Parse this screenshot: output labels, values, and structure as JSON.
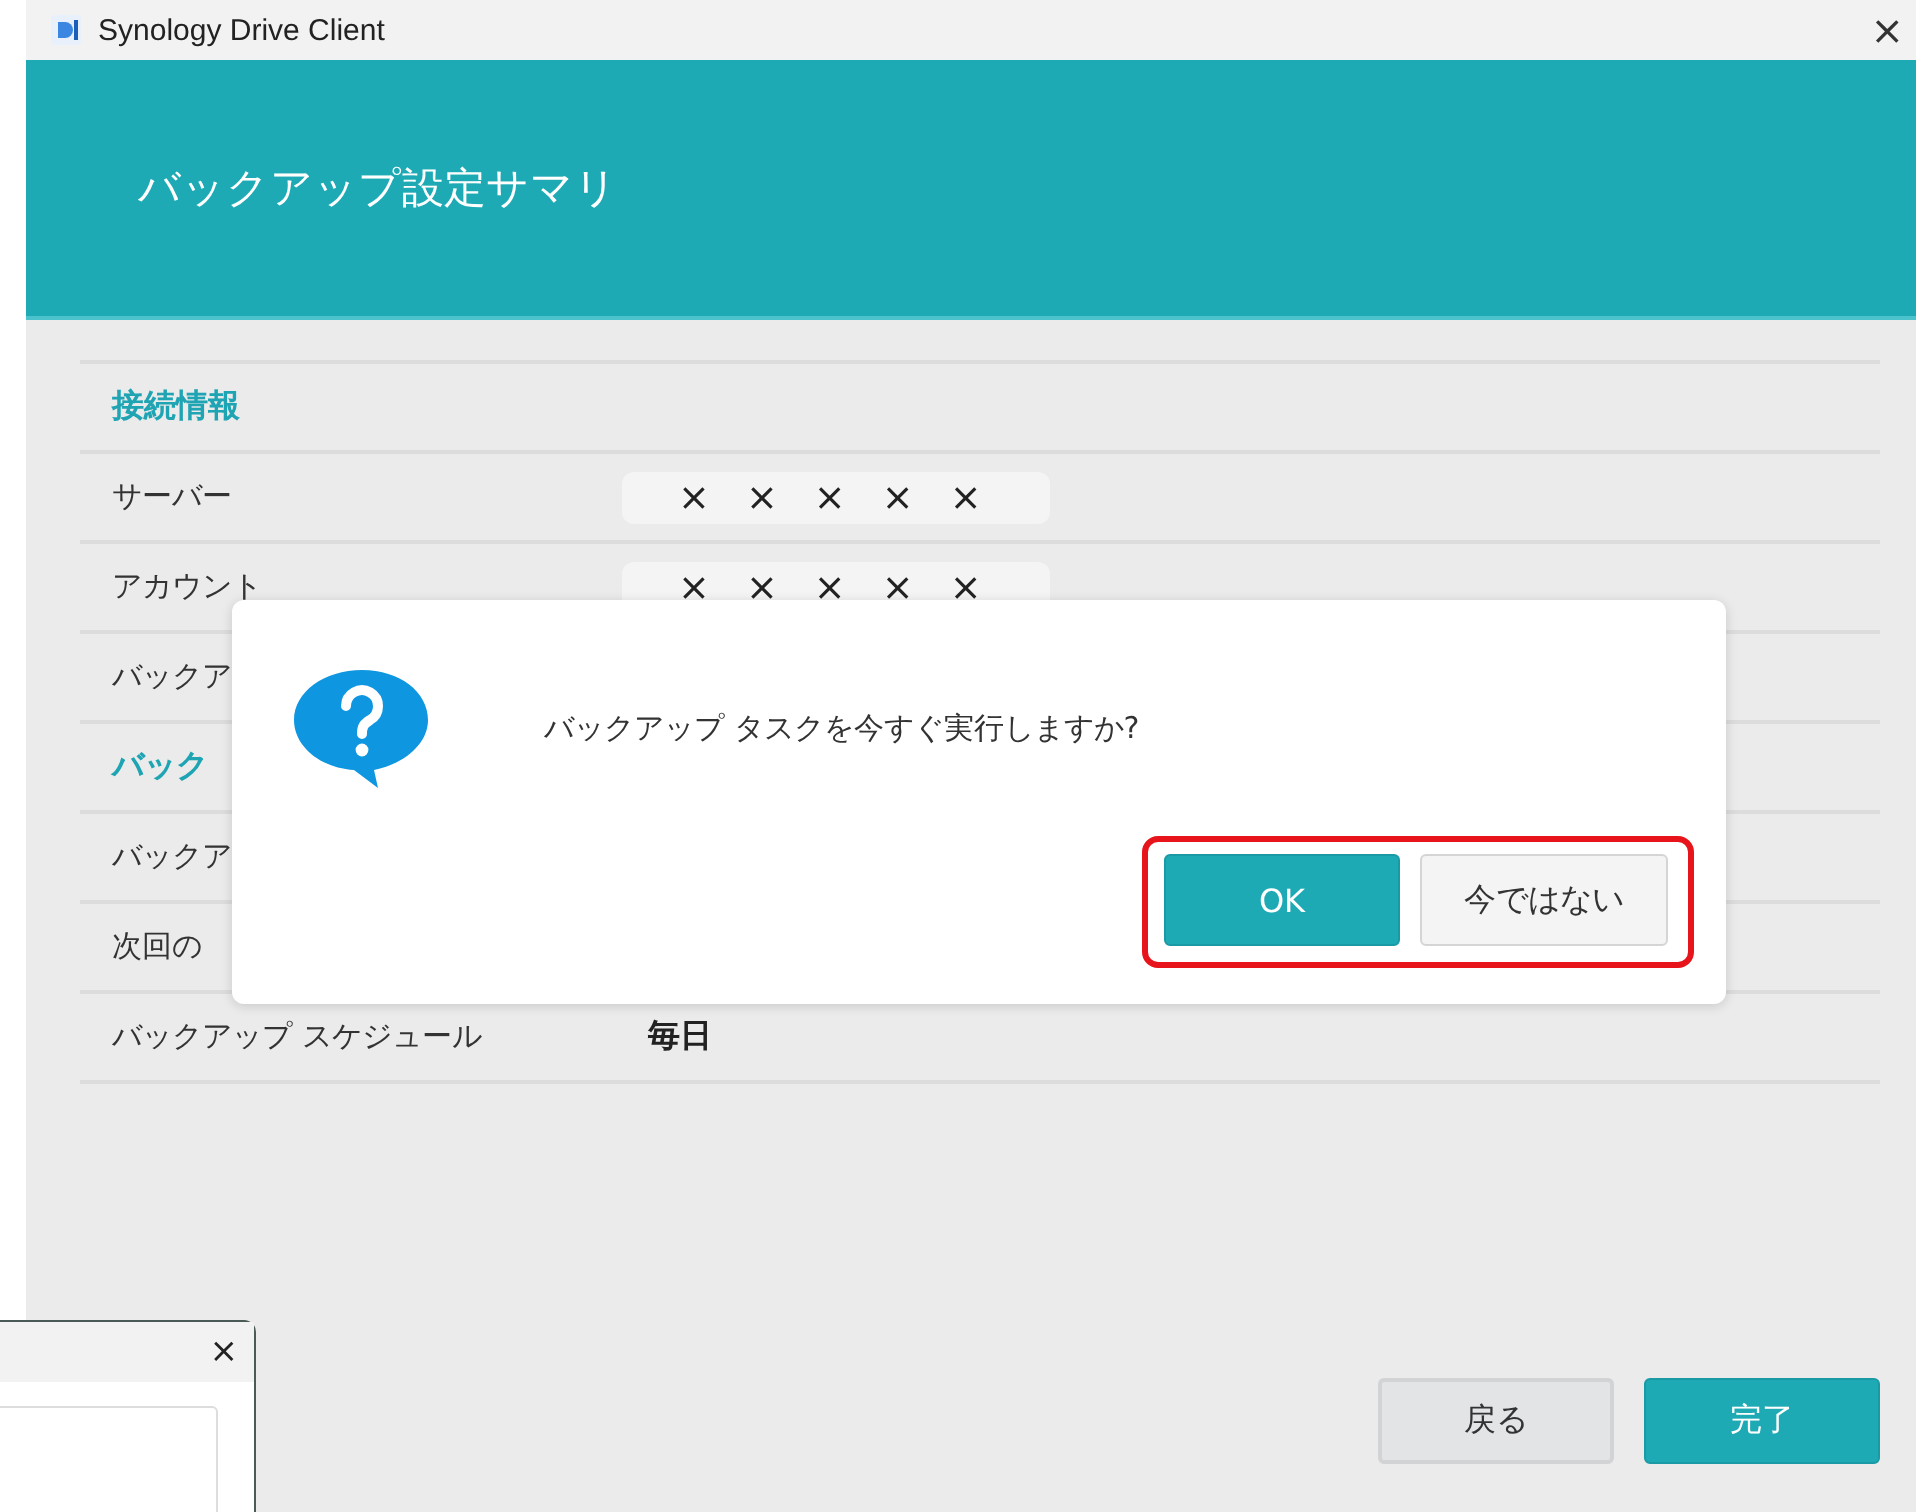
{
  "window": {
    "title": "Synology Drive Client",
    "close": "×"
  },
  "header": {
    "title": "バックアップ設定サマリ"
  },
  "sections": [
    {
      "heading": "接続情報",
      "rows": [
        {
          "label": "サーバー",
          "value": "× × × × ×",
          "masked": true
        },
        {
          "label": "アカウント",
          "value": "× × × × ×",
          "masked": true
        },
        {
          "label": "バックア"
        }
      ]
    },
    {
      "heading": "バック",
      "rows": [
        {
          "label": "バックア"
        },
        {
          "label": "次回の"
        },
        {
          "label": "バックアップ スケジュール",
          "value": "毎日",
          "masked": false
        }
      ]
    }
  ],
  "footer_buttons": [
    {
      "label": "戻る",
      "kind": "secondary"
    },
    {
      "label": "完了",
      "kind": "primary"
    }
  ],
  "dialog": {
    "message": "バックアップ タスクを今すぐ実行しますか?",
    "highlighted": true,
    "buttons": [
      {
        "label": "OK",
        "kind": "primary"
      },
      {
        "label": "今ではない",
        "kind": "secondary"
      }
    ]
  },
  "background_window": {
    "close": "×"
  }
}
